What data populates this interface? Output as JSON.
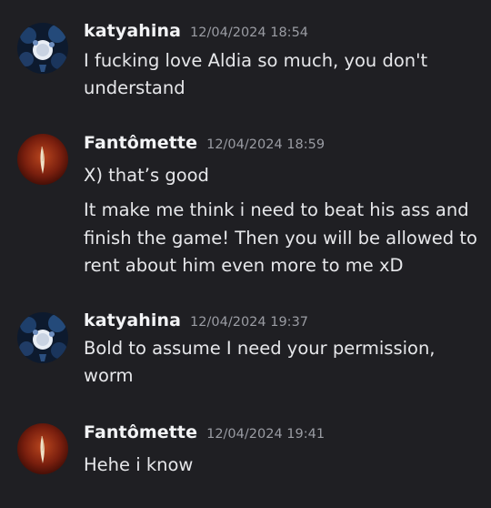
{
  "messages": [
    {
      "author": "katyahina",
      "timestamp": "12/04/2024 18:54",
      "avatar": "katyahina-avatar",
      "lines": [
        "I fucking love Aldia so much, you don't",
        "understand"
      ]
    },
    {
      "author": "Fantômette",
      "timestamp": "12/04/2024 18:59",
      "avatar": "fantomette-avatar",
      "lines": [
        "X) that’s good"
      ],
      "followup_lines": [
        "It make me think i need to beat his ass and",
        "finish the game! Then you will be allowed to",
        "rent about him even more to me xD"
      ]
    },
    {
      "author": "katyahina",
      "timestamp": "12/04/2024 19:37",
      "avatar": "katyahina-avatar",
      "lines": [
        "Bold to assume I need your permission,",
        "worm"
      ]
    },
    {
      "author": "Fantômette",
      "timestamp": "12/04/2024 19:41",
      "avatar": "fantomette-avatar",
      "lines": [
        "Hehe i know"
      ]
    }
  ],
  "colors": {
    "background": "#1f1f23",
    "author": "#f2f3f5",
    "timestamp": "#9a9ca3",
    "text": "#e6e7ea"
  }
}
